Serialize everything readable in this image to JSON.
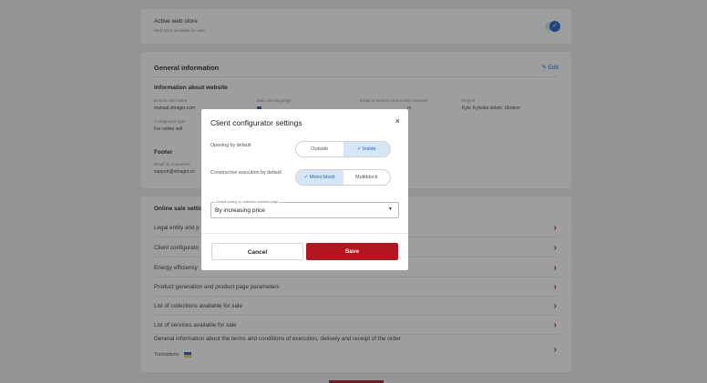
{
  "store": {
    "title": "Active web store",
    "subtitle": "Web store available for user"
  },
  "general": {
    "title": "General information",
    "edit_label": "Edit",
    "website_heading": "Information about website",
    "fields": [
      {
        "label": "Domain site name",
        "value": "manual.vitrager.com"
      },
      {
        "label": "Main site language",
        "value": ""
      },
      {
        "label": "Email to receive partnership requests",
        "value": "m"
      },
      {
        "label": "Region",
        "value": "Kyiv, Kyivska oblast, Ukraine"
      }
    ],
    "config_type_label": "Configurator type",
    "config_type_value": "For online sell",
    "footer_heading": "Footer",
    "footer_email_label": "Email for customers",
    "footer_email_value": "support@vitrager.co"
  },
  "online": {
    "title": "Online sale settin",
    "rows": [
      {
        "label": "Legal entity and p"
      },
      {
        "label": "Client configurato"
      },
      {
        "label": "Energy efficiency"
      },
      {
        "label": "Product generation and product page parameters"
      },
      {
        "label": "List of collections available for sale"
      },
      {
        "label": "List of services available for sale"
      }
    ],
    "terms_label": "General information about the terms and conditions of execution, delivery and receipt of the order",
    "translations_label": "Translations:"
  },
  "modal": {
    "title": "Client configurator settings",
    "close_glyph": "×",
    "opening_label": "Opening by default",
    "opening_options": [
      {
        "label": "Outside",
        "active": false
      },
      {
        "label": "✓  Inside",
        "active": true
      }
    ],
    "execution_label": "Constructive execution by default",
    "execution_options": [
      {
        "label": "✓  Mono block",
        "active": true
      },
      {
        "label": "Multiblock",
        "active": false
      }
    ],
    "sorting_legend": "Default sorting on collection selection page",
    "sorting_value": "By increasing price",
    "cancel_label": "Cancel",
    "save_label": "Save"
  },
  "colors": {
    "accent_red": "#b3161f",
    "accent_blue": "#1a62c2",
    "selected_bg": "#d6e6f7"
  }
}
